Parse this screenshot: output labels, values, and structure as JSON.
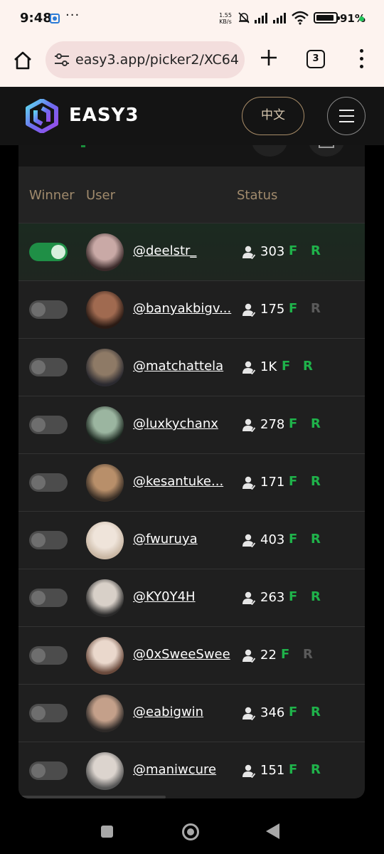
{
  "status_bar": {
    "time": "9:48",
    "more": "···",
    "net_speed_value": "1.55",
    "net_speed_unit": "KB/s",
    "battery": "91%",
    "icons": [
      "app-notification-icon",
      "mute-bell-icon",
      "signal-icon",
      "signal-icon",
      "wifi-icon",
      "battery-icon"
    ]
  },
  "browser": {
    "url": "easy3.app/picker2/XC64",
    "tab_count": "3",
    "icons": [
      "home-icon",
      "tune-icon",
      "plus-icon",
      "tabs-icon",
      "menu-dots-icon"
    ]
  },
  "site": {
    "logo_text": "EASY3",
    "lang_button": "中文",
    "menu_icon": "hamburger-icon"
  },
  "colors": {
    "accent_green": "#1fb24a",
    "header_gold": "#a08a6c",
    "card_bg": "#1f1f1f"
  },
  "table": {
    "headers": {
      "winner": "Winner",
      "user": "User",
      "status": "Status"
    },
    "rows": [
      {
        "winner": true,
        "username": "@deelstr_",
        "followers": "303",
        "f": "F",
        "r": "R",
        "r_active": true
      },
      {
        "winner": false,
        "username": "@banyakbigv...",
        "followers": "175",
        "f": "F",
        "r": "R",
        "r_active": false
      },
      {
        "winner": false,
        "username": "@matchattela",
        "followers": "1K",
        "f": "F",
        "r": "R",
        "r_active": true
      },
      {
        "winner": false,
        "username": "@luxkychanx",
        "followers": "278",
        "f": "F",
        "r": "R",
        "r_active": true
      },
      {
        "winner": false,
        "username": "@kesantuke...",
        "followers": "171",
        "f": "F",
        "r": "R",
        "r_active": true
      },
      {
        "winner": false,
        "username": "@fwuruya",
        "followers": "403",
        "f": "F",
        "r": "R",
        "r_active": true
      },
      {
        "winner": false,
        "username": "@KY0Y4H",
        "followers": "263",
        "f": "F",
        "r": "R",
        "r_active": true
      },
      {
        "winner": false,
        "username": "@0xSweeSwee",
        "followers": "22",
        "f": "F",
        "r": "R",
        "r_active": false
      },
      {
        "winner": false,
        "username": "@eabigwin",
        "followers": "346",
        "f": "F",
        "r": "R",
        "r_active": true
      },
      {
        "winner": false,
        "username": "@maniwcure",
        "followers": "151",
        "f": "F",
        "r": "R",
        "r_active": true
      }
    ]
  },
  "nav": {
    "icons": [
      "recents-icon",
      "home-circle-icon",
      "back-icon"
    ]
  }
}
